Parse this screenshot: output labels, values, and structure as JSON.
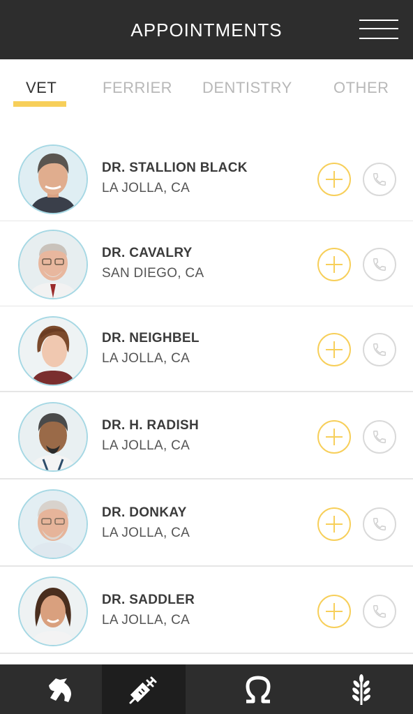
{
  "header": {
    "title": "APPOINTMENTS",
    "menu_icon": "hamburger-menu-icon"
  },
  "tabs": [
    {
      "label": "VET",
      "active": true
    },
    {
      "label": "FERRIER",
      "active": false
    },
    {
      "label": "DENTISTRY",
      "active": false
    },
    {
      "label": "OTHER",
      "active": false
    }
  ],
  "doctors": [
    {
      "name": "DR. STALLION BLACK",
      "location": "LA JOLLA, CA"
    },
    {
      "name": "DR. CAVALRY",
      "location": "SAN DIEGO, CA"
    },
    {
      "name": "DR. NEIGHBEL",
      "location": "LA JOLLA, CA"
    },
    {
      "name": "DR. H. RADISH",
      "location": "LA JOLLA, CA"
    },
    {
      "name": "DR. DONKAY",
      "location": "LA JOLLA, CA"
    },
    {
      "name": "DR. SADDLER",
      "location": "LA JOLLA, CA"
    }
  ],
  "bottom_nav": [
    {
      "icon": "horse-head-icon",
      "active": false
    },
    {
      "icon": "syringe-icon",
      "active": true
    },
    {
      "icon": "horseshoe-icon",
      "active": false
    },
    {
      "icon": "wheat-icon",
      "active": false
    }
  ],
  "colors": {
    "header_bg": "#2d2d2d",
    "accent_yellow": "#f7cf5a",
    "avatar_ring": "#a6d8e4",
    "call_ring": "#d9d9d9"
  }
}
